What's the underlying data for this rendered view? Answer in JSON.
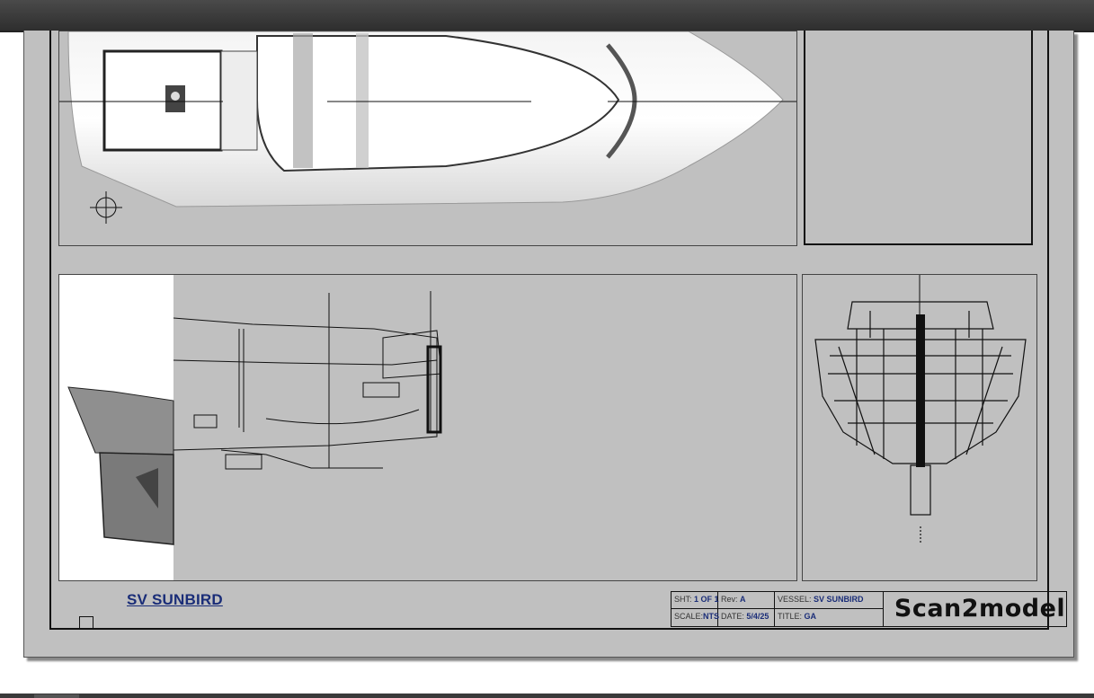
{
  "vessel_label": "SV SUNBIRD",
  "title_block": {
    "sheet_label": "SHT:",
    "sheet_value": "1 OF 1",
    "rev_label": "Rev:",
    "rev_value": "A",
    "vessel_label": "VESSEL:",
    "vessel_value": "SV SUNBIRD",
    "scale_label": "SCALE:",
    "scale_value": "NTS",
    "date_label": "DATE:",
    "date_value": "5/4/25",
    "title_label": "TITLE:",
    "title_value": "GA",
    "logo_text": "Scan2model"
  },
  "colors": {
    "sheet": "#c0c0c0",
    "accent": "#1a2d78",
    "toolbar": "#3a3a3a"
  }
}
